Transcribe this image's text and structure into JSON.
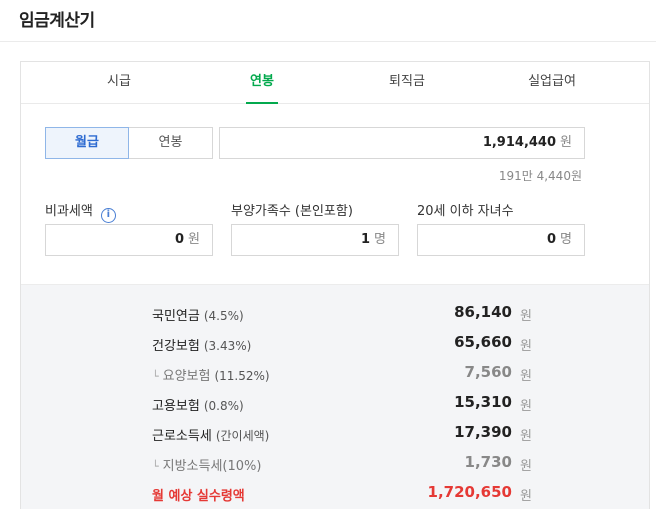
{
  "app": {
    "title": "임금계산기"
  },
  "tabs": [
    {
      "label": "시급"
    },
    {
      "label": "연봉"
    },
    {
      "label": "퇴직금"
    },
    {
      "label": "실업급여"
    }
  ],
  "active_tab": "연봉",
  "accent_color": "#03a94d",
  "pay_type": {
    "options": [
      "월급",
      "연봉"
    ],
    "selected": "월급"
  },
  "amount": {
    "value": "1,914,440",
    "unit": "원",
    "hint": "191만 4,440원"
  },
  "fields": {
    "nontax": {
      "label": "비과세액",
      "value": "0",
      "unit": "원",
      "icon": "info-icon"
    },
    "dependents": {
      "label": "부양가족수 (본인포함)",
      "value": "1",
      "unit": "명"
    },
    "children": {
      "label": "20세 이하 자녀수",
      "value": "0",
      "unit": "명"
    }
  },
  "results": [
    {
      "label": "국민연금",
      "rate": "(4.5%)",
      "value": "86,140",
      "unit": "원"
    },
    {
      "label": "건강보험",
      "rate": "(3.43%)",
      "value": "65,660",
      "unit": "원"
    },
    {
      "label": "요양보험",
      "rate": "(11.52%)",
      "value": "7,560",
      "unit": "원",
      "sub": true,
      "arrow": "└"
    },
    {
      "label": "고용보험",
      "rate": "(0.8%)",
      "value": "15,310",
      "unit": "원"
    },
    {
      "label": "근로소득세",
      "rate": "(간이세액)",
      "value": "17,390",
      "unit": "원"
    },
    {
      "label": "지방소득세(10%)",
      "rate": "",
      "value": "1,730",
      "unit": "원",
      "sub": true,
      "arrow": "└"
    },
    {
      "label": "월 예상 실수령액",
      "rate": "",
      "value": "1,720,650",
      "unit": "원",
      "total": true
    }
  ]
}
